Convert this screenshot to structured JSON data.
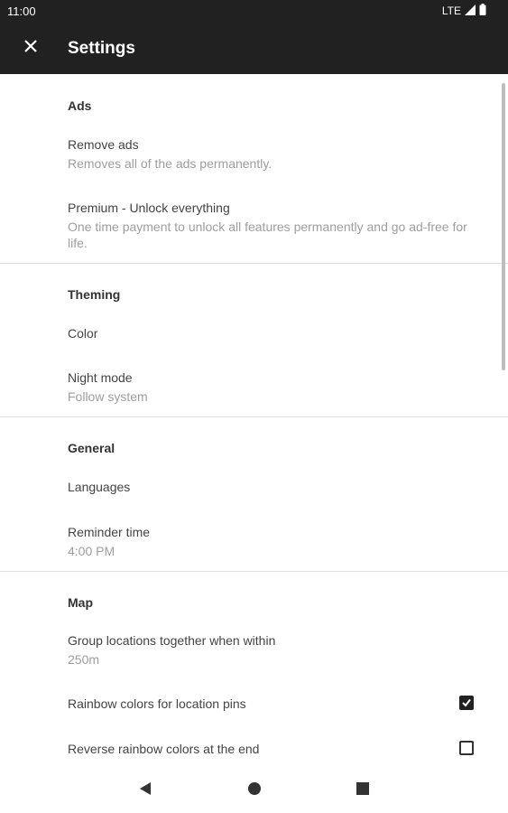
{
  "status_bar": {
    "time": "11:00",
    "network": "LTE",
    "icons": [
      "signal-icon",
      "battery-icon"
    ]
  },
  "toolbar": {
    "title": "Settings",
    "close_icon": "close-icon"
  },
  "sections": {
    "ads": {
      "header": "Ads",
      "remove_ads": {
        "title": "Remove ads",
        "summary": "Removes all of the ads permanently."
      },
      "premium": {
        "title": "Premium - Unlock everything",
        "summary": "One time payment to unlock all features permanently and go ad-free for life."
      }
    },
    "theming": {
      "header": "Theming",
      "color": {
        "title": "Color"
      },
      "night_mode": {
        "title": "Night mode",
        "summary": "Follow system"
      }
    },
    "general": {
      "header": "General",
      "languages": {
        "title": "Languages"
      },
      "reminder_time": {
        "title": "Reminder time",
        "summary": "4:00 PM"
      }
    },
    "map": {
      "header": "Map",
      "group_locations": {
        "title": "Group locations together when within",
        "summary": "250m"
      },
      "rainbow_colors": {
        "title": "Rainbow colors for location pins",
        "checked": true
      },
      "reverse_rainbow": {
        "title": "Reverse rainbow colors at the end",
        "checked": false
      }
    }
  },
  "nav_bar": {
    "icons": [
      "back-icon",
      "home-icon",
      "recents-icon"
    ]
  },
  "colors": {
    "toolbar_bg": "#212121",
    "background": "#ffffff",
    "summary_text": "#9e9e9e",
    "divider": "#e0e0e0"
  }
}
